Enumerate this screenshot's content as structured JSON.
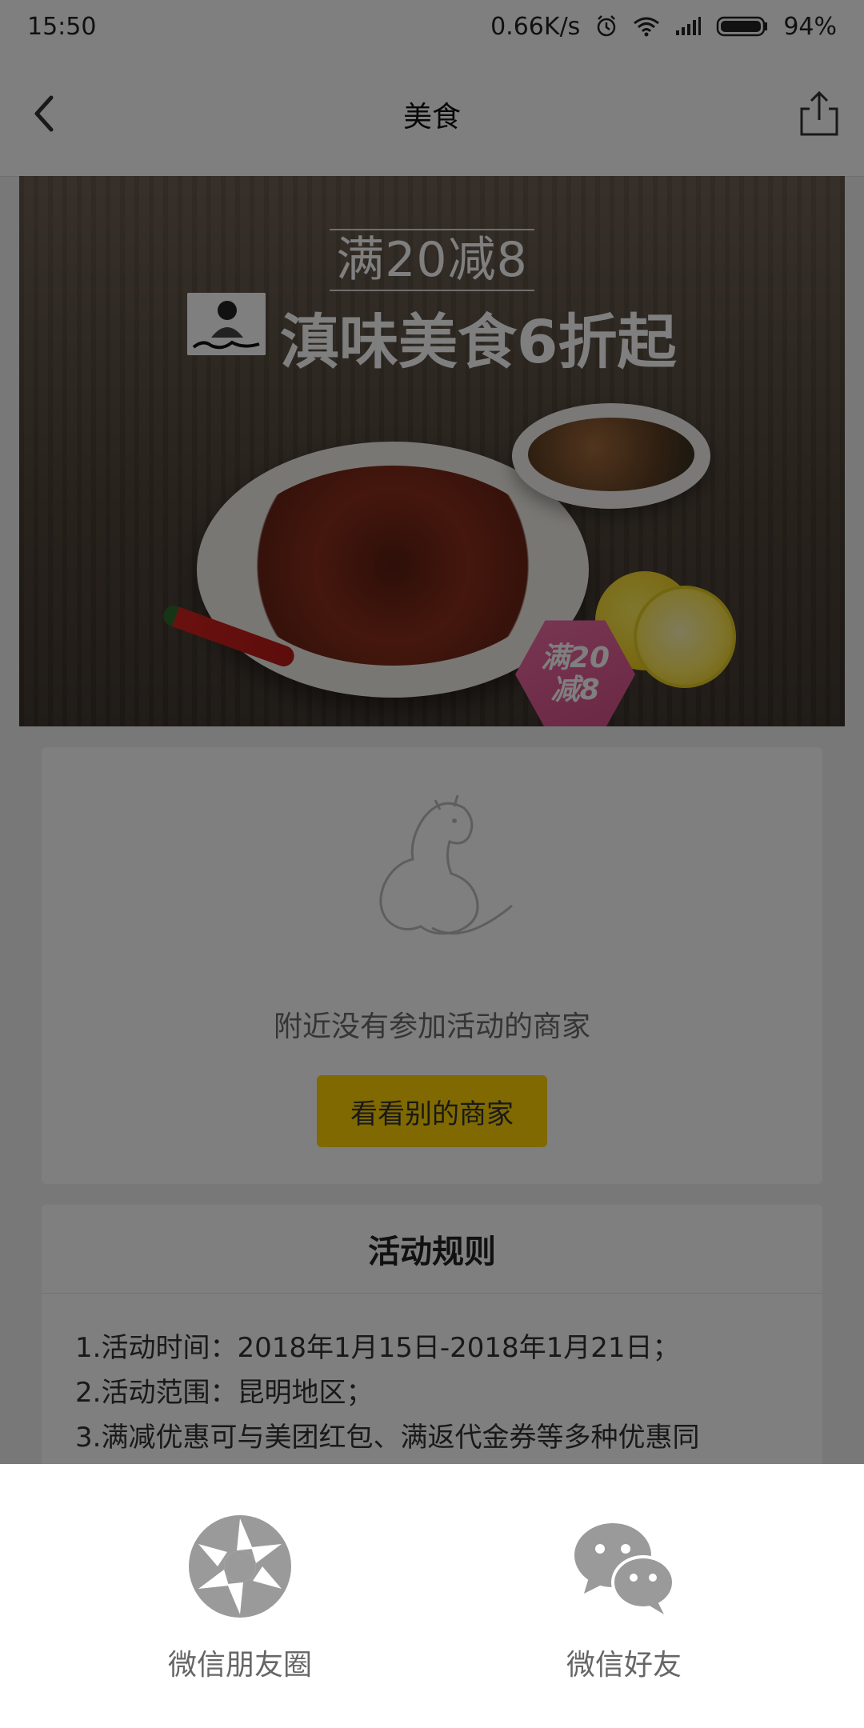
{
  "status_bar": {
    "time": "15:50",
    "network_speed": "0.66K/s",
    "battery": "94%",
    "icons": [
      "alarm-icon",
      "wifi-icon",
      "signal-icon",
      "battery-icon"
    ]
  },
  "nav": {
    "title": "美食",
    "back_icon": "back-icon",
    "share_icon": "share-icon"
  },
  "banner": {
    "offer": "满20减8",
    "headline": "滇味美食6折起",
    "badge": "满20\n减8"
  },
  "empty_state": {
    "message": "附近没有参加活动的商家",
    "button_label": "看看别的商家"
  },
  "rules": {
    "title": "活动规则",
    "items": [
      "1.活动时间：2018年1月15日-2018年1月21日；",
      "2.活动范围：昆明地区；",
      "3.满减优惠可与美团红包、满返代金券等多种优惠同"
    ]
  },
  "share_sheet": {
    "options": [
      {
        "label": "微信朋友圈",
        "icon": "wechat-moments-icon"
      },
      {
        "label": "微信好友",
        "icon": "wechat-friends-icon"
      }
    ]
  },
  "colors": {
    "accent_yellow": "#ffd200",
    "overlay": "rgba(0,0,0,0.5)"
  }
}
